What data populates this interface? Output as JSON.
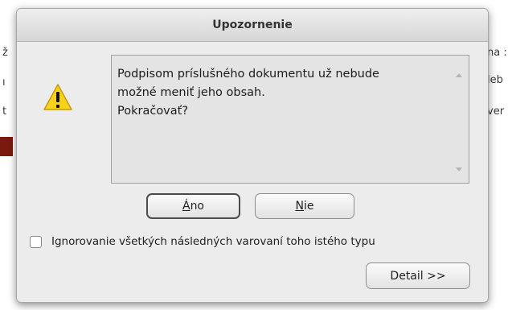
{
  "background": {
    "fragments": [
      "ž",
      "ı",
      "t",
      "na :",
      "leb",
      "ver"
    ]
  },
  "dialog": {
    "title": "Upozornenie",
    "icon": "warning-icon",
    "message": "Podpisom príslušného dokumentu už nebude\nmožné meniť jeho obsah.\nPokračovať?",
    "buttons": {
      "yes": {
        "accesskey": "Á",
        "rest": "no"
      },
      "no": {
        "accesskey": "N",
        "rest": "ie"
      },
      "detail": "Detail >>"
    },
    "checkbox": {
      "label": "Ignorovanie všetkých následných varovaní toho istého typu",
      "checked": false
    }
  },
  "colors": {
    "warning_yellow": "#f7d21b",
    "background_accent": "#7a1a0c"
  }
}
